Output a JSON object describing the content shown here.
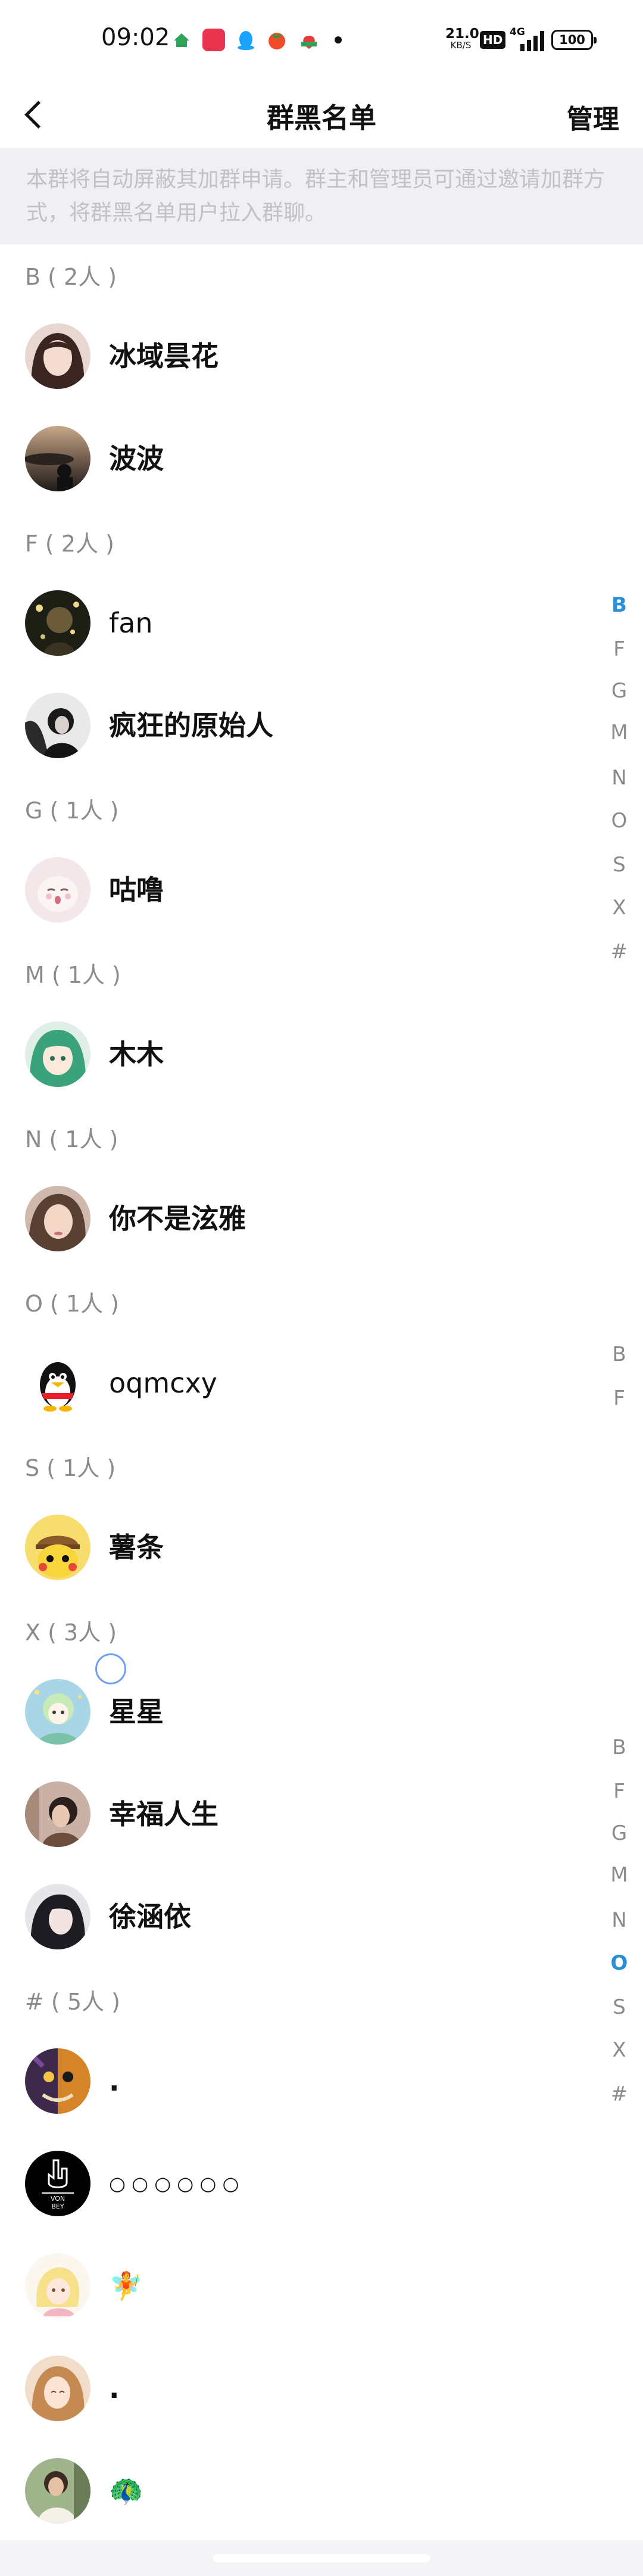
{
  "status_bar": {
    "time": "09:02",
    "net_speed": "21.0",
    "net_unit": "KB/S",
    "hd": "HD",
    "network": "4G",
    "battery": "100"
  },
  "nav": {
    "back_icon": "chevron-left-icon",
    "title": "群黑名单",
    "manage_label": "管理"
  },
  "notice": "本群将自动屏蔽其加群申请。群主和管理员可通过邀请加群方式，将群黑名单用户拉入群聊。",
  "sections": [
    {
      "header": "B ( 2人 )",
      "members": [
        {
          "name": "冰域昙花"
        },
        {
          "name": "波波"
        }
      ]
    },
    {
      "header": "F ( 2人 )",
      "members": [
        {
          "name": "fan"
        },
        {
          "name": "疯狂的原始人"
        }
      ]
    },
    {
      "header": "G ( 1人 )",
      "members": [
        {
          "name": "咕噜"
        }
      ]
    },
    {
      "header": "M ( 1人 )",
      "members": [
        {
          "name": "木木"
        }
      ]
    },
    {
      "header": "N ( 1人 )",
      "members": [
        {
          "name": "你不是泫雅"
        }
      ]
    },
    {
      "header": "O ( 1人 )",
      "members": [
        {
          "name": "oqmcxy"
        }
      ]
    },
    {
      "header": "S ( 1人 )",
      "members": [
        {
          "name": "薯条"
        }
      ]
    },
    {
      "header": "X ( 3人 )",
      "members": [
        {
          "name": "星星"
        },
        {
          "name": "幸福人生"
        },
        {
          "name": "徐涵依"
        }
      ]
    },
    {
      "header": "# ( 5人 )",
      "members": [
        {
          "name": "."
        },
        {
          "name": "○ ○ ○ ○ ○ ○"
        },
        {
          "name": "🧚"
        },
        {
          "name": "."
        },
        {
          "name": "🦚"
        }
      ]
    }
  ],
  "index_bars": [
    {
      "letters": [
        "B",
        "F",
        "G",
        "M",
        "N",
        "O",
        "S",
        "X",
        "#"
      ],
      "active": "B"
    },
    {
      "letters": [
        "B",
        "F"
      ],
      "active": ""
    },
    {
      "letters": [
        "B",
        "F",
        "G",
        "M",
        "N",
        "O",
        "S",
        "X",
        "#"
      ],
      "active": "O"
    }
  ]
}
